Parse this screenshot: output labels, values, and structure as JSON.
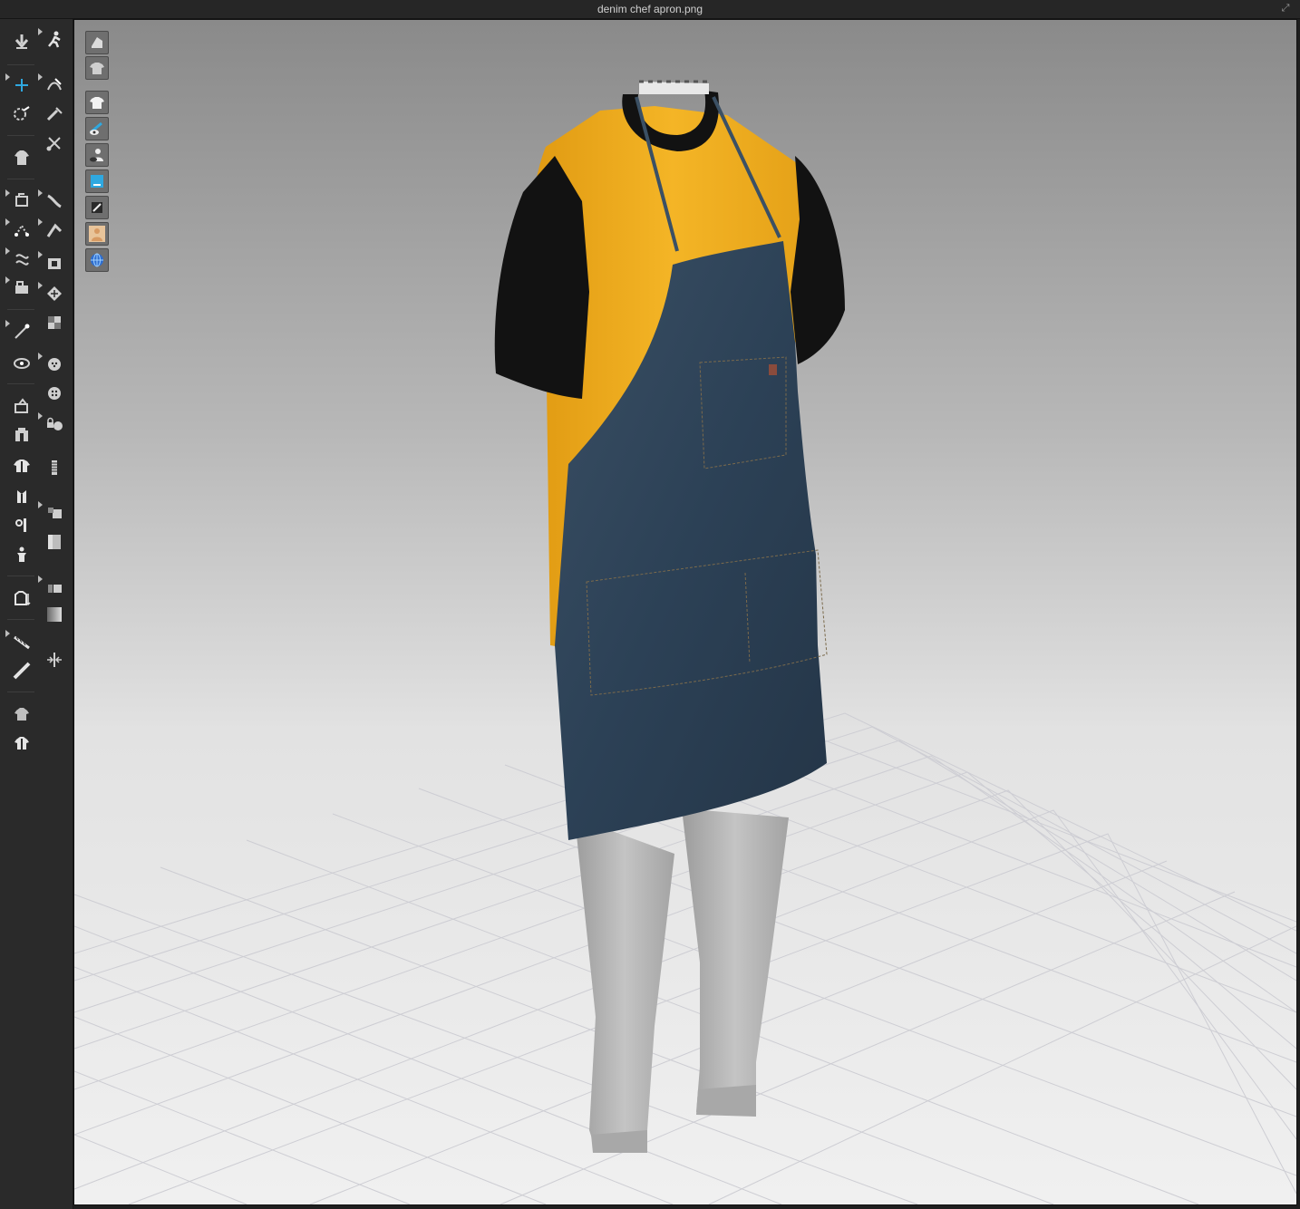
{
  "window": {
    "title": "denim chef apron.png",
    "restore_glyph": "⤢"
  },
  "left_toolbar": {
    "column1_icons": [
      "simulation-arrow-icon",
      "select-move-icon",
      "transform-pattern-icon",
      "garment-fit-icon",
      "sewing-icon",
      "segment-sewing-icon",
      "free-sewing-icon",
      "fold-arrangement-icon",
      "pin-icon",
      "tack-icon",
      "arrangement-icon",
      "avatar-measure-icon",
      "garment-tshirt-icon",
      "body-front-icon",
      "body-side-icon",
      "avatar-figure-icon",
      "shirt-hanger-icon",
      "tape-icon",
      "ruler-icon",
      "shirt-stack-icon",
      "shirt-shadow-icon"
    ],
    "column2_icons": [
      "avatar-walk-icon",
      "edit-curve-icon",
      "edit-pin-icon",
      "scissors-icon",
      "seam-line-icon",
      "fold-line-icon",
      "texture-edit-icon",
      "pattern-grid-icon",
      "checker-icon",
      "button-icon",
      "button-small-icon",
      "lock-button-icon",
      "zipper-icon",
      "layer-icon",
      "fill-square-icon",
      "layer-small-icon",
      "gradient-square-icon",
      "align-icon"
    ]
  },
  "viewport_toolbar": {
    "icons": [
      "view-3d-box-icon",
      "view-tshirt-icon",
      "shirt-white-icon",
      "eye-edit-icon",
      "eye-avatar-icon",
      "view-blue-cube-icon",
      "view-dark-icon",
      "avatar-skin-icon",
      "globe-icon"
    ]
  },
  "colors": {
    "tshirt_body": "#f2b11f",
    "tshirt_sleeve": "#111111",
    "apron_denim": "#2d4256",
    "pants_gray": "#b7b7b7",
    "grid_line": "#cfcfd4",
    "accent_blue": "#2fa8e0"
  }
}
